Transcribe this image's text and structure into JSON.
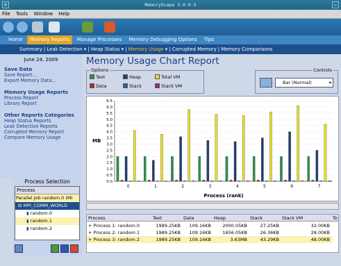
{
  "window": {
    "title": "MemoryScape 3.0.0-5"
  },
  "menu": [
    "File",
    "Tools",
    "Window",
    "Help"
  ],
  "nav_tabs": [
    {
      "label": "Home",
      "active": false
    },
    {
      "label": "Memory Reports",
      "active": true
    },
    {
      "label": "Manage Processes",
      "active": false
    },
    {
      "label": "Memory Debugging Options",
      "active": false
    },
    {
      "label": "Tips",
      "active": false
    }
  ],
  "sub_nav": [
    {
      "label": "Summary",
      "dropdown": false,
      "active": false
    },
    {
      "label": "Leak Detection",
      "dropdown": true,
      "active": false
    },
    {
      "label": "Heap Status",
      "dropdown": true,
      "active": false
    },
    {
      "label": "Memory Usage",
      "dropdown": true,
      "active": true
    },
    {
      "label": "Corrupted Memory",
      "dropdown": false,
      "active": false
    },
    {
      "label": "Memory Comparisons",
      "dropdown": false,
      "active": false
    }
  ],
  "sidebar": {
    "date": "June 24, 2009",
    "sections": [
      {
        "title": "Save Data",
        "links": [
          "Save Report...",
          "Export Memory Data..."
        ]
      },
      {
        "title": "Memory Usage Reports",
        "links": [
          "Process Report",
          "Library Report"
        ]
      },
      {
        "title": "Other Reports Categories",
        "links": [
          "Heap Status Reports",
          "Leak Detection Reports",
          "Corrupted Memory Report",
          "Compare Memory Usage"
        ]
      }
    ]
  },
  "process_selection": {
    "title": "Process Selection",
    "column": "Process",
    "rows": [
      {
        "label": "Parallel Job random.0 (MI",
        "indent": 0,
        "selected": false,
        "highlight": true
      },
      {
        "label": "MPI_COMM_WORLD",
        "indent": 1,
        "selected": true,
        "highlight": false
      },
      {
        "label": "random.0",
        "indent": 2,
        "selected": false,
        "highlight": false
      },
      {
        "label": "random.1",
        "indent": 2,
        "selected": false,
        "highlight": true
      },
      {
        "label": "random.2",
        "indent": 2,
        "selected": false,
        "highlight": false
      }
    ]
  },
  "main": {
    "title": "Memory Usage Chart Report",
    "options_label": "Options",
    "options": [
      {
        "label": "Text",
        "color": "#2f8f4e"
      },
      {
        "label": "Heap",
        "color": "#223e74"
      },
      {
        "label": "Total VM",
        "color": "#e6e02a"
      },
      {
        "label": "Data",
        "color": "#b22a2a"
      },
      {
        "label": "Stack",
        "color": "#2a5fa8"
      },
      {
        "label": "Stack VM",
        "color": "#8a2a84"
      }
    ],
    "controls_label": "Controls",
    "chart_type": "Bar (Normal)"
  },
  "chart_data": {
    "type": "bar",
    "categories": [
      "0",
      "1",
      "2",
      "3",
      "4",
      "5",
      "6",
      "7"
    ],
    "series": [
      {
        "name": "Text",
        "color": "#2f8f4e",
        "values": [
          2.0,
          2.0,
          2.0,
          2.0,
          2.0,
          2.0,
          2.0,
          2.0
        ]
      },
      {
        "name": "Data",
        "color": "#b22a2a",
        "values": [
          0.1,
          0.1,
          0.1,
          0.1,
          0.1,
          0.1,
          0.1,
          0.1
        ]
      },
      {
        "name": "Heap",
        "color": "#223e74",
        "values": [
          2.0,
          1.7,
          3.6,
          3.3,
          3.2,
          3.5,
          4.0,
          2.5
        ]
      },
      {
        "name": "Stack",
        "color": "#2a5fa8",
        "values": [
          0.03,
          0.03,
          0.04,
          0.04,
          0.04,
          0.04,
          0.04,
          0.04
        ]
      },
      {
        "name": "Total VM",
        "color": "#e6e02a",
        "values": [
          4.1,
          3.8,
          5.8,
          5.4,
          5.3,
          5.6,
          6.1,
          4.6
        ]
      },
      {
        "name": "Stack VM",
        "color": "#8a2a84",
        "values": [
          0.03,
          0.03,
          0.05,
          0.05,
          0.05,
          0.05,
          0.05,
          0.05
        ]
      }
    ],
    "xlabel": "Process (rank)",
    "ylabel": "MB",
    "ylim": [
      0,
      6.5
    ],
    "yticks": [
      "0.0",
      "0.5",
      "1.0",
      "1.5",
      "2.0",
      "2.5",
      "3.0",
      "3.5",
      "4.0",
      "4.5",
      "5.0",
      "5.5",
      "6.0",
      "6.5"
    ]
  },
  "table": {
    "columns": [
      "Process",
      "Text",
      "Data",
      "Heap",
      "Stack",
      "Stack VM",
      "To"
    ],
    "rows": [
      [
        "Process 1: random.0",
        "1989.25KB",
        "109.16KB",
        "2000.05KB",
        "27.25KB",
        "32.00KB"
      ],
      [
        "Process 2: random.1",
        "1989.25KB",
        "109.16KB",
        "1656.05KB",
        "26.36KB",
        "28.00KB"
      ],
      [
        "Process 3: random.2",
        "1989.25KB",
        "109.16KB",
        "3.63MB",
        "43.29KB",
        "48.00KB"
      ]
    ]
  }
}
